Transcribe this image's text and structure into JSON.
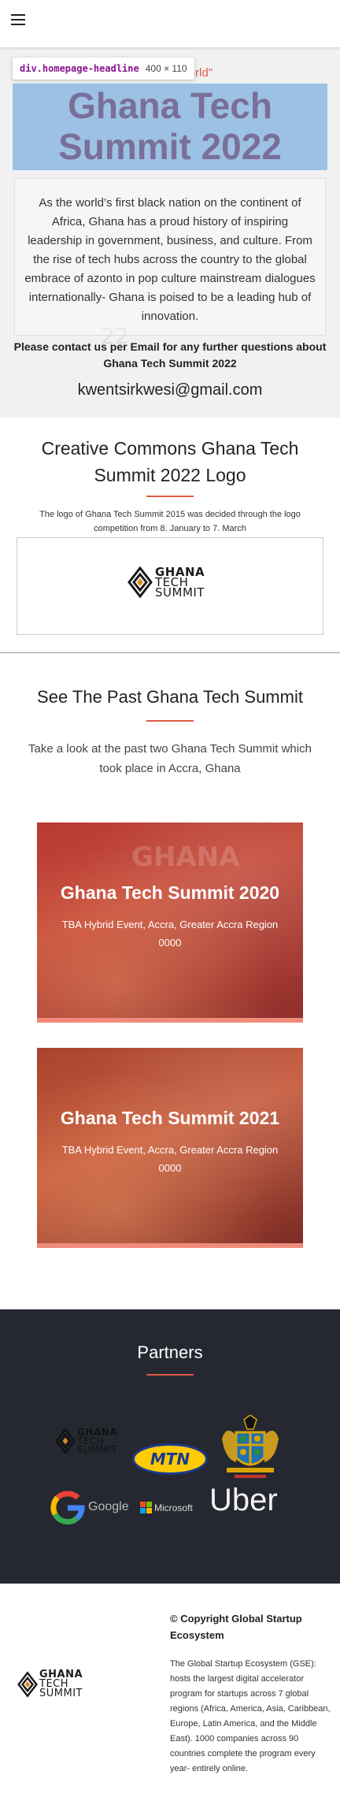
{
  "nav": {
    "menu_icon": "hamburger-icon"
  },
  "hero": {
    "tagline": "Technologically World\"",
    "headline_line1": "Ghana Tech",
    "headline_line2": "Summit 2022",
    "devtools": {
      "tag": "div.homepage-headline",
      "dims": "400 × 110"
    },
    "intro": "As the world’s first black nation on the continent of Africa, Ghana has a proud history of inspiring leadership in government, business, and culture. From the rise of tech hubs across the country to the global embrace of azonto in pop culture mainstream dialogues internationally- Ghana is poised to be a leading hub of innovation.",
    "contact_text": "Please contact us per Email for any further questions about Ghana Tech Summit 2022",
    "email": "kwentsirkwesi@gmail.com",
    "bg_text": "22"
  },
  "creative_commons": {
    "title": "Creative Commons Ghana Tech Summit 2022 Logo",
    "text": "The logo of Ghana Tech Summit 2015 was decided through the logo competition from 8. January to 7. March",
    "logo": {
      "line1": "GHANA",
      "line2": "TECH",
      "line3": "SUMMIT"
    }
  },
  "past": {
    "title": "See The Past Ghana Tech Summit",
    "text": "Take a look at the past two Ghana Tech Summit which took place in Accra, Ghana",
    "cards": [
      {
        "title": "Ghana Tech Summit 2020",
        "location": "TBA Hybrid Event, Accra, Greater Accra Region",
        "code": "0000",
        "watermark": "GHANA"
      },
      {
        "title": "Ghana Tech Summit 2021",
        "location": "TBA Hybrid Event, Accra, Greater Accra Region",
        "code": "0000",
        "watermark": ""
      }
    ]
  },
  "partners": {
    "title": "Partners",
    "mtn": "MTN",
    "google": "Google",
    "microsoft": "Microsoft",
    "uber": "Uber"
  },
  "footer": {
    "copyright": "© Copyright Global Startup Ecosystem",
    "description": "The Global Startup Ecosystem (GSE): hosts the largest digital accelerator program for startups across 7 global regions (Africa, America, Asia, Caribbean, Europe, Latin America, and the Middle East). 1000 companies across 90 countries complete the program every year- entirely online."
  },
  "colors": {
    "accent": "#e05a47",
    "dark_bg": "#252830",
    "card_red": "#b93a34",
    "highlight_blue": "#6fa8dc"
  }
}
